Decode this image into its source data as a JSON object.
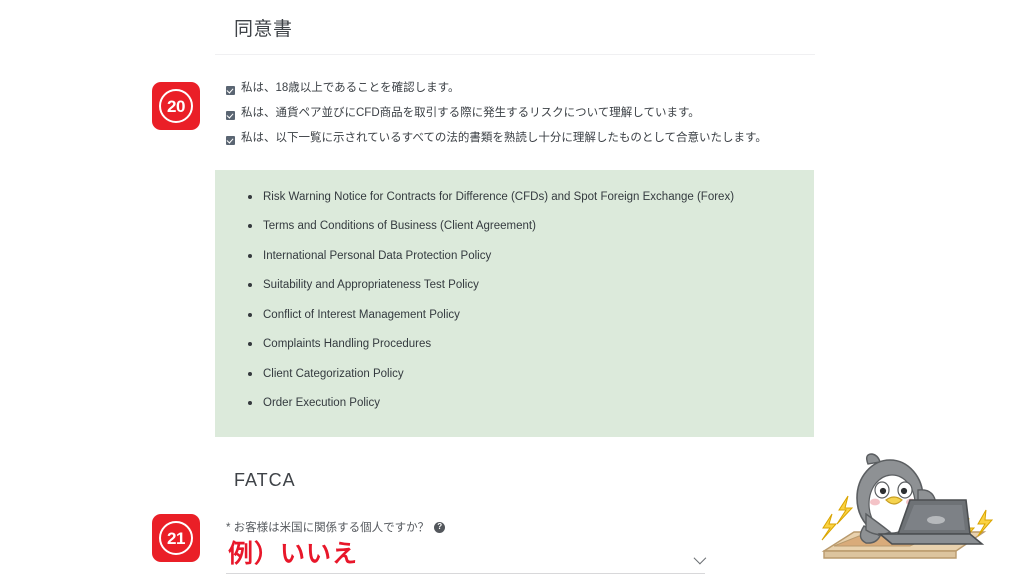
{
  "sections": {
    "agreement_heading": "同意書",
    "fatca_heading": "FATCA"
  },
  "step_badges": [
    {
      "name": "step-20",
      "number": "20"
    },
    {
      "name": "step-21",
      "number": "21"
    }
  ],
  "consents": [
    {
      "checked": true,
      "text": "私は、18歳以上であることを確認します。"
    },
    {
      "checked": true,
      "text": "私は、通貨ペア並びにCFD商品を取引する際に発生するリスクについて理解しています。"
    },
    {
      "checked": true,
      "text": "私は、以下一覧に示されているすべての法的書類を熟読し十分に理解したものとして合意いたします。"
    }
  ],
  "documents": [
    "Risk Warning Notice for Contracts for Difference (CFDs) and Spot Foreign Exchange (Forex)",
    "Terms and Conditions of Business (Client Agreement)",
    "International Personal Data Protection Policy",
    "Suitability and Appropriateness Test Policy",
    "Conflict of Interest Management Policy",
    "Complaints Handling Procedures",
    "Client Categorization Policy",
    "Order Execution Policy"
  ],
  "fatca_field": {
    "label": "* お客様は米国に関係する個人ですか？",
    "help_icon": "question-mark-help-icon",
    "selected_value": "",
    "chevron_icon": "chevron-down-icon"
  },
  "annotation": {
    "text": "例）いいえ",
    "color": "#e8172a"
  },
  "mascot": {
    "name": "penguin-at-laptop-illustration",
    "body_color": "#8e9194",
    "belly_color": "#ffffff",
    "beak_color": "#f5d34f",
    "laptop_color": "#6e7276",
    "desk_color": "#e2c9a4",
    "spark_color": "#fbd242"
  },
  "colors": {
    "page_background": "#ffffff",
    "panel_green": "#dceadb",
    "badge_red": "#ea1f27",
    "text_dark": "#3c4146",
    "divider": "#f0f0f2"
  }
}
